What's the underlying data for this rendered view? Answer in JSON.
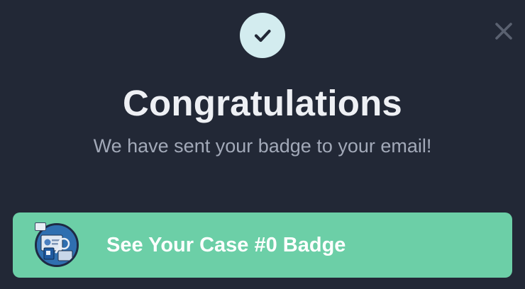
{
  "dialog": {
    "title": "Congratulations",
    "message": "We have sent your badge to your email!",
    "close_icon": "close-icon",
    "success_icon": "checkmark-icon"
  },
  "cta": {
    "label": "See Your Case #0 Badge",
    "thumbnail_icon": "badge-thumbnail"
  },
  "colors": {
    "background": "#222836",
    "title": "#eef0f4",
    "subtitle": "#a2a9b8",
    "check_circle_bg": "#d3ecef",
    "check_mark": "#222836",
    "close_icon": "#5a6170",
    "cta_bg": "#6ccfa7",
    "cta_text": "#ffffff"
  }
}
